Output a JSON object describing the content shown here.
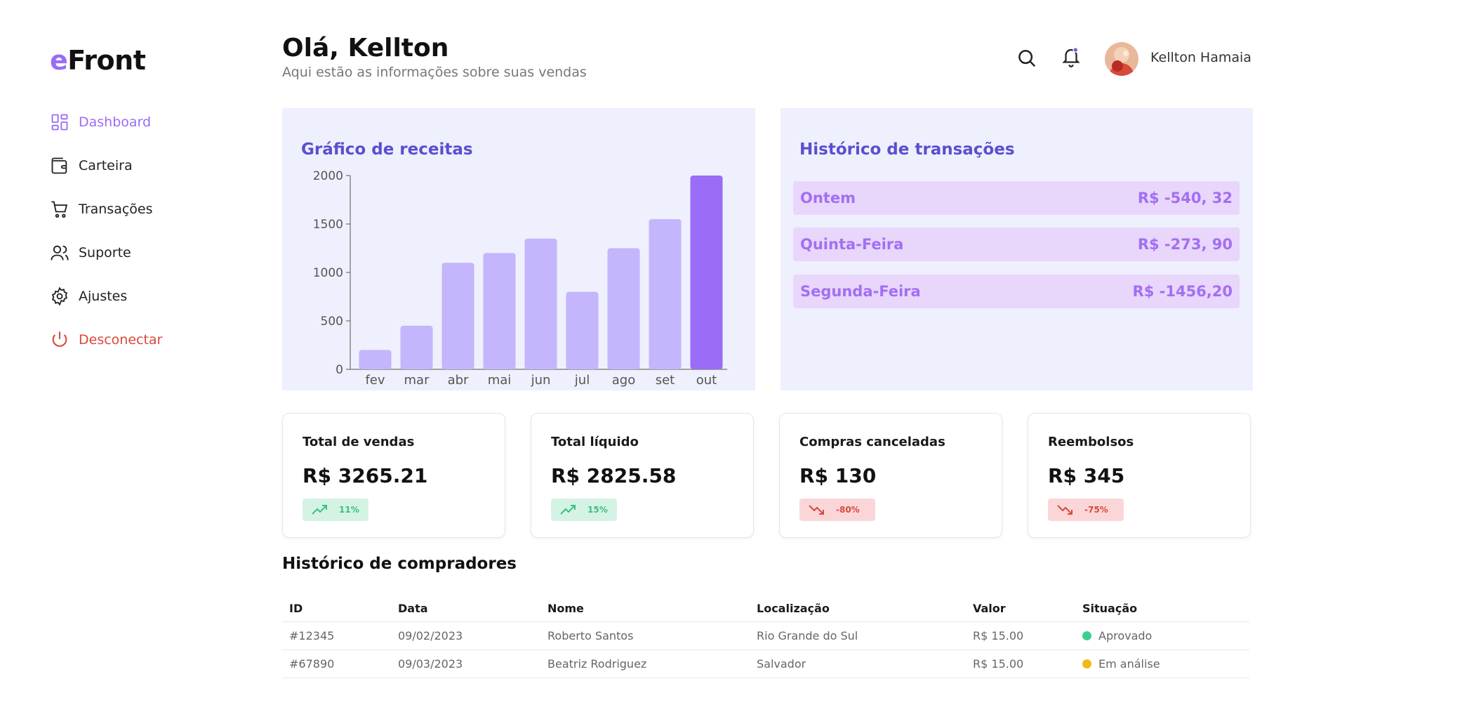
{
  "brand": {
    "e": "e",
    "rest": "Front"
  },
  "sidebar": {
    "items": [
      {
        "label": "Dashboard"
      },
      {
        "label": "Carteira"
      },
      {
        "label": "Transações"
      },
      {
        "label": "Suporte"
      },
      {
        "label": "Ajustes"
      },
      {
        "label": "Desconectar"
      }
    ]
  },
  "header": {
    "greeting": "Olá, Kellton",
    "subtitle": "Aqui estão as informações sobre suas vendas",
    "user_name": "Kellton Hamaia"
  },
  "revenue_panel": {
    "title": "Gráfico de receitas"
  },
  "chart_data": {
    "type": "bar",
    "categories": [
      "fev",
      "mar",
      "abr",
      "mai",
      "jun",
      "jul",
      "ago",
      "set",
      "out"
    ],
    "values": [
      200,
      450,
      1100,
      1200,
      1350,
      800,
      1250,
      1550,
      2000
    ],
    "highlight_index": 8,
    "ylim": [
      0,
      2000
    ],
    "yticks": [
      0,
      500,
      1000,
      1500,
      2000
    ],
    "colors": {
      "bar": "#c4b5fc",
      "highlight": "#9b6cf6",
      "axis": "#888888"
    }
  },
  "transactions_panel": {
    "title": "Histórico de transações",
    "rows": [
      {
        "label": "Ontem",
        "value": "R$ -540, 32"
      },
      {
        "label": "Quinta-Feira",
        "value": "R$ -273, 90"
      },
      {
        "label": "Segunda-Feira",
        "value": "R$ -1456,20"
      }
    ]
  },
  "stats": [
    {
      "title": "Total de vendas",
      "value": "R$ 3265.21",
      "change": "11%",
      "trend": "up"
    },
    {
      "title": "Total líquido",
      "value": "R$ 2825.58",
      "change": "15%",
      "trend": "up"
    },
    {
      "title": "Compras canceladas",
      "value": "R$ 130",
      "change": "-80%",
      "trend": "down"
    },
    {
      "title": "Reembolsos",
      "value": "R$ 345",
      "change": "-75%",
      "trend": "down"
    }
  ],
  "buyers": {
    "title": "Histórico de compradores",
    "columns": [
      "ID",
      "Data",
      "Nome",
      "Localização",
      "Valor",
      "Situação"
    ],
    "rows": [
      {
        "id": "#12345",
        "date": "09/02/2023",
        "name": "Roberto Santos",
        "location": "Rio Grande do Sul",
        "value": "R$ 15.00",
        "status": "Aprovado",
        "status_color": "#3ccf91"
      },
      {
        "id": "#67890",
        "date": "09/03/2023",
        "name": "Beatriz Rodriguez",
        "location": "Salvador",
        "value": "R$ 15.00",
        "status": "Em análise",
        "status_color": "#f0b81a"
      }
    ]
  }
}
